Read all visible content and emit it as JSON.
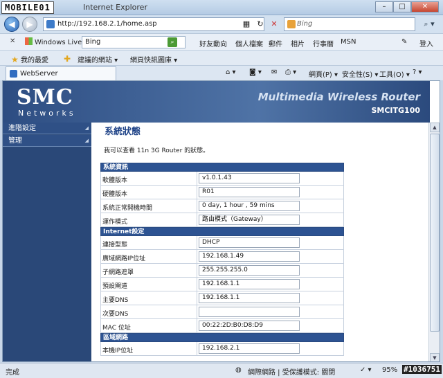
{
  "window": {
    "watermark": "MOBILE01",
    "title": "Internet Explorer",
    "buttons": {
      "minimize": "–",
      "maximize": "□",
      "close": "✕"
    }
  },
  "address_bar": {
    "url": "http://192.168.2.1/home.asp",
    "search_engine": "Bing"
  },
  "live_toolbar": {
    "brand": "Windows Live",
    "search_value": "Bing",
    "links": [
      "好友動向",
      "個人檔案",
      "郵件",
      "相片",
      "行事曆",
      "MSN"
    ],
    "signin": "登入"
  },
  "favorites": {
    "label": "我的最愛",
    "items": [
      "建議的網站 ▾",
      "網頁快訊圖庫 ▾"
    ]
  },
  "tab": {
    "title": "WebServer"
  },
  "commands": {
    "page": "網頁(P) ▾",
    "safety": "安全性(S) ▾",
    "tools": "工具(O) ▾"
  },
  "router": {
    "brand": "SMC",
    "brand_sub": "Networks",
    "product": "Multimedia Wireless Router",
    "model": "SMCITG100"
  },
  "sidebar": {
    "items": [
      {
        "label": "進階設定"
      },
      {
        "label": "管理"
      }
    ]
  },
  "content": {
    "title": "系統狀態",
    "description": "我可以查看 11n 3G Router 的狀態。",
    "sections": [
      {
        "title": "系統資訊",
        "rows": [
          {
            "label": "軟體版本",
            "value": "v1.0.1.43"
          },
          {
            "label": "硬體版本",
            "value": "R01"
          },
          {
            "label": "系統正常開機時間",
            "value": " 0 day,  1 hour , 59 mins"
          },
          {
            "label": "運作模式",
            "value": "路由模式（Gateway）"
          }
        ]
      },
      {
        "title": "Internet設定",
        "rows": [
          {
            "label": "連接型態",
            "value": "DHCP"
          },
          {
            "label": "廣域網路IP位址",
            "value": "192.168.1.49"
          },
          {
            "label": "子網路遮罩",
            "value": "255.255.255.0"
          },
          {
            "label": "預設閘道",
            "value": "192.168.1.1"
          },
          {
            "label": "主要DNS",
            "value": "192.168.1.1"
          },
          {
            "label": "次要DNS",
            "value": ""
          },
          {
            "label": "MAC 位址",
            "value": "00:22:2D:B0:D8:D9"
          }
        ]
      },
      {
        "title": "區域網路",
        "rows": [
          {
            "label": "本機IP位址",
            "value": "192.168.2.1"
          }
        ]
      }
    ]
  },
  "status_bar": {
    "left": "完成",
    "zone": "網際網路 | 受保護模式: 關閉",
    "zoom": "95%",
    "watermark": "#1036751"
  }
}
